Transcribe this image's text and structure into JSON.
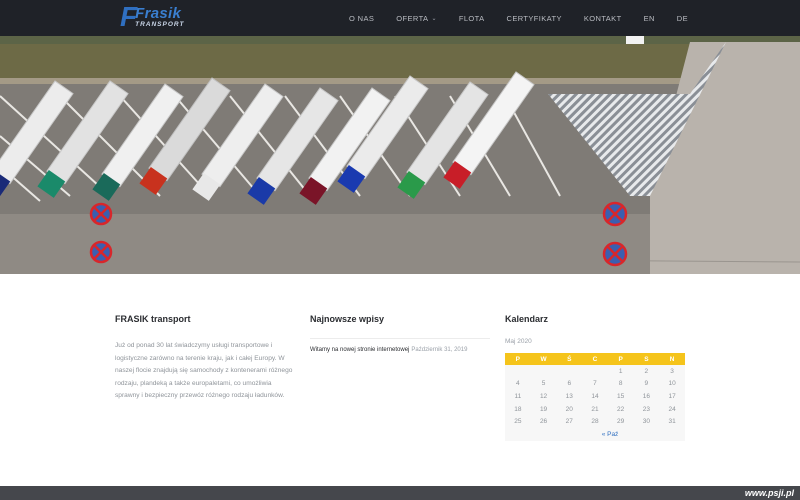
{
  "header": {
    "logo": {
      "main": "Frasik",
      "sub": "TRANSPORT",
      "letter": "F"
    },
    "nav": [
      {
        "label": "O NAS"
      },
      {
        "label": "OFERTA",
        "has_dropdown": true
      },
      {
        "label": "FLOTA"
      },
      {
        "label": "CERTYFIKATY"
      },
      {
        "label": "KONTAKT"
      },
      {
        "label": "EN"
      },
      {
        "label": "DE"
      }
    ]
  },
  "hero": {
    "image": "aerial-view-parked-trucks",
    "truck_cab_colors": [
      "#1a2a78",
      "#1a8a6a",
      "#1a6a5a",
      "#c8321e",
      "#e8e8e8",
      "#1a3aa8",
      "#7a1428",
      "#1a3ab0",
      "#2a9a4a",
      "#c81e28"
    ]
  },
  "about": {
    "title": "FRASIK transport",
    "text": "Już od ponad 30 lat świadczymy usługi transportowe i logistyczne zarówno na terenie kraju, jak i całej Europy. W naszej flocie znajdują się samochody z kontenerami różnego rodzaju, plandeką a także europaletami, co umożliwia sprawny i bezpieczny przewóz różnego rodzaju ładunków."
  },
  "recent_posts": {
    "title": "Najnowsze wpisy",
    "items": [
      {
        "title": "Witamy na nowej stronie internetowej",
        "date": "Październik 31, 2019"
      }
    ]
  },
  "calendar": {
    "title": "Kalendarz",
    "caption": "Maj 2020",
    "weekdays": [
      "P",
      "W",
      "Ś",
      "C",
      "P",
      "S",
      "N"
    ],
    "weeks": [
      [
        "",
        "",
        "",
        "",
        "1",
        "2",
        "3"
      ],
      [
        "4",
        "5",
        "6",
        "7",
        "8",
        "9",
        "10"
      ],
      [
        "11",
        "12",
        "13",
        "14",
        "15",
        "16",
        "17"
      ],
      [
        "18",
        "19",
        "20",
        "21",
        "22",
        "23",
        "24"
      ],
      [
        "25",
        "26",
        "27",
        "28",
        "29",
        "30",
        "31"
      ]
    ],
    "prev_label": "« Paź"
  },
  "footer": {
    "watermark": "www.psji.pl"
  },
  "colors": {
    "header_bg": "#1f2228",
    "accent_yellow": "#f5c41b",
    "link_blue": "#2f6fc0",
    "footer_bg": "#45474c"
  }
}
